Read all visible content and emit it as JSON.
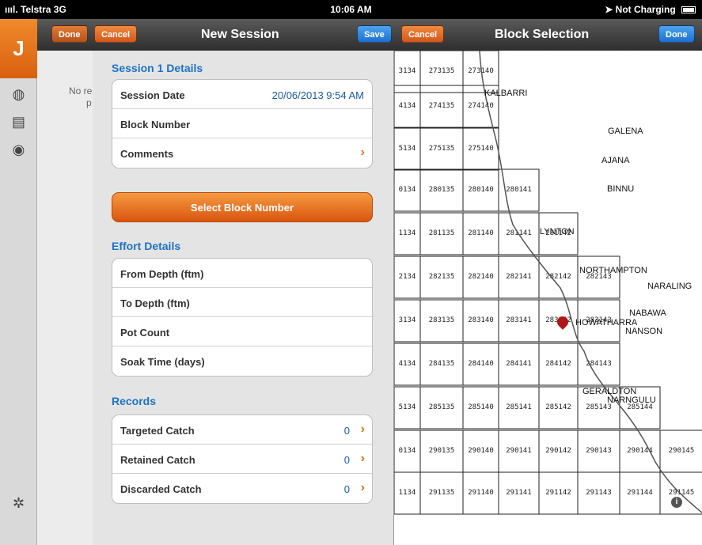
{
  "status_bar": {
    "carrier": "ıııl. Telstra  3G",
    "time": "10:06 AM",
    "battery": "➤ Not Charging"
  },
  "rail": {
    "logo_glyph": "J",
    "icons": [
      "globe-icon",
      "list-icon",
      "lifebuoy-icon",
      "settings-icon"
    ]
  },
  "background_list": {
    "empty_text_line1": "No re",
    "empty_text_line2": "p"
  },
  "session": {
    "done_label": "Done",
    "cancel_label": "Cancel",
    "title": "New Session",
    "save_label": "Save",
    "details_heading": "Session 1 Details",
    "details_rows": [
      {
        "label": "Session Date",
        "value": "20/06/2013 9:54 AM"
      },
      {
        "label": "Block Number",
        "value": ""
      },
      {
        "label": "Comments",
        "value": ""
      }
    ],
    "select_block_label": "Select Block Number",
    "effort_heading": "Effort Details",
    "effort_rows": [
      "From Depth (ftm)",
      "To Depth (ftm)",
      "Pot Count",
      "Soak Time (days)"
    ],
    "records_heading": "Records",
    "records_rows": [
      {
        "label": "Targeted Catch",
        "count": "0"
      },
      {
        "label": "Retained Catch",
        "count": "0"
      },
      {
        "label": "Discarded Catch",
        "count": "0"
      }
    ]
  },
  "block_selection": {
    "cancel_label": "Cancel",
    "title": "Block Selection",
    "done_label": "Done",
    "places": [
      "KALBARRI",
      "GALENA",
      "AJANA",
      "BINNU",
      "LYNTON",
      "NORTHAMPTON",
      "NARALING",
      "NABAWA",
      "HOWATHARRA",
      "NANSON",
      "GERALDTON",
      "NARNGULU"
    ],
    "rows": [
      [
        "3134",
        "273135",
        "273140"
      ],
      [
        "4134",
        "274135",
        "274140"
      ],
      [
        "5134",
        "275135",
        "275140"
      ],
      [
        "0134",
        "280135",
        "280140",
        "280141"
      ],
      [
        "1134",
        "281135",
        "281140",
        "281141",
        "281142"
      ],
      [
        "2134",
        "282135",
        "282140",
        "282141",
        "282142",
        "282143"
      ],
      [
        "3134",
        "283135",
        "283140",
        "283141",
        "283142",
        "283143"
      ],
      [
        "4134",
        "284135",
        "284140",
        "284141",
        "284142",
        "284143"
      ],
      [
        "5134",
        "285135",
        "285140",
        "285141",
        "285142",
        "285143",
        "285144"
      ],
      [
        "0134",
        "290135",
        "290140",
        "290141",
        "290142",
        "290143",
        "290144",
        "290145"
      ],
      [
        "1134",
        "291135",
        "291140",
        "291141",
        "291142",
        "291143",
        "291144",
        "291145"
      ]
    ]
  },
  "colors": {
    "accent_orange": "#e2701d",
    "link_blue": "#1e72c4",
    "navbar_dark": "#3a3a3a"
  }
}
